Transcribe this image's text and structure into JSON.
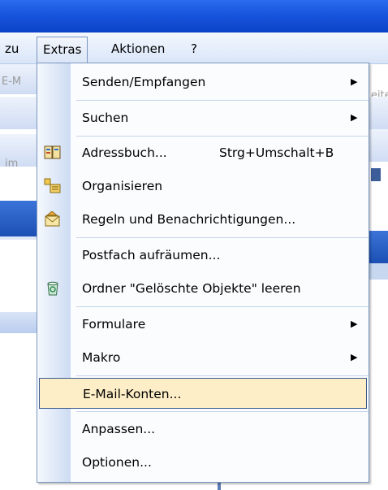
{
  "menubar": {
    "zu": "zu",
    "extras": "Extras",
    "aktionen": "Aktionen",
    "help": "?"
  },
  "background": {
    "left_text_1": "E-M",
    "left_text_2": "im",
    "right_text": "eite"
  },
  "menu": {
    "senden_empfangen": "Senden/Empfangen",
    "suchen": "Suchen",
    "adressbuch": "Adressbuch...",
    "adressbuch_shortcut": "Strg+Umschalt+B",
    "organisieren": "Organisieren",
    "regeln": "Regeln und Benachrichtigungen...",
    "postfach": "Postfach aufräumen...",
    "ordner_leeren": "Ordner \"Gelöschte Objekte\" leeren",
    "formulare": "Formulare",
    "makro": "Makro",
    "email_konten": "E-Mail-Konten...",
    "anpassen": "Anpassen...",
    "optionen": "Optionen..."
  },
  "colors": {
    "titlebar": "#0b43c6",
    "highlight": "#fdeec7",
    "menu_border": "#7a96c0"
  }
}
